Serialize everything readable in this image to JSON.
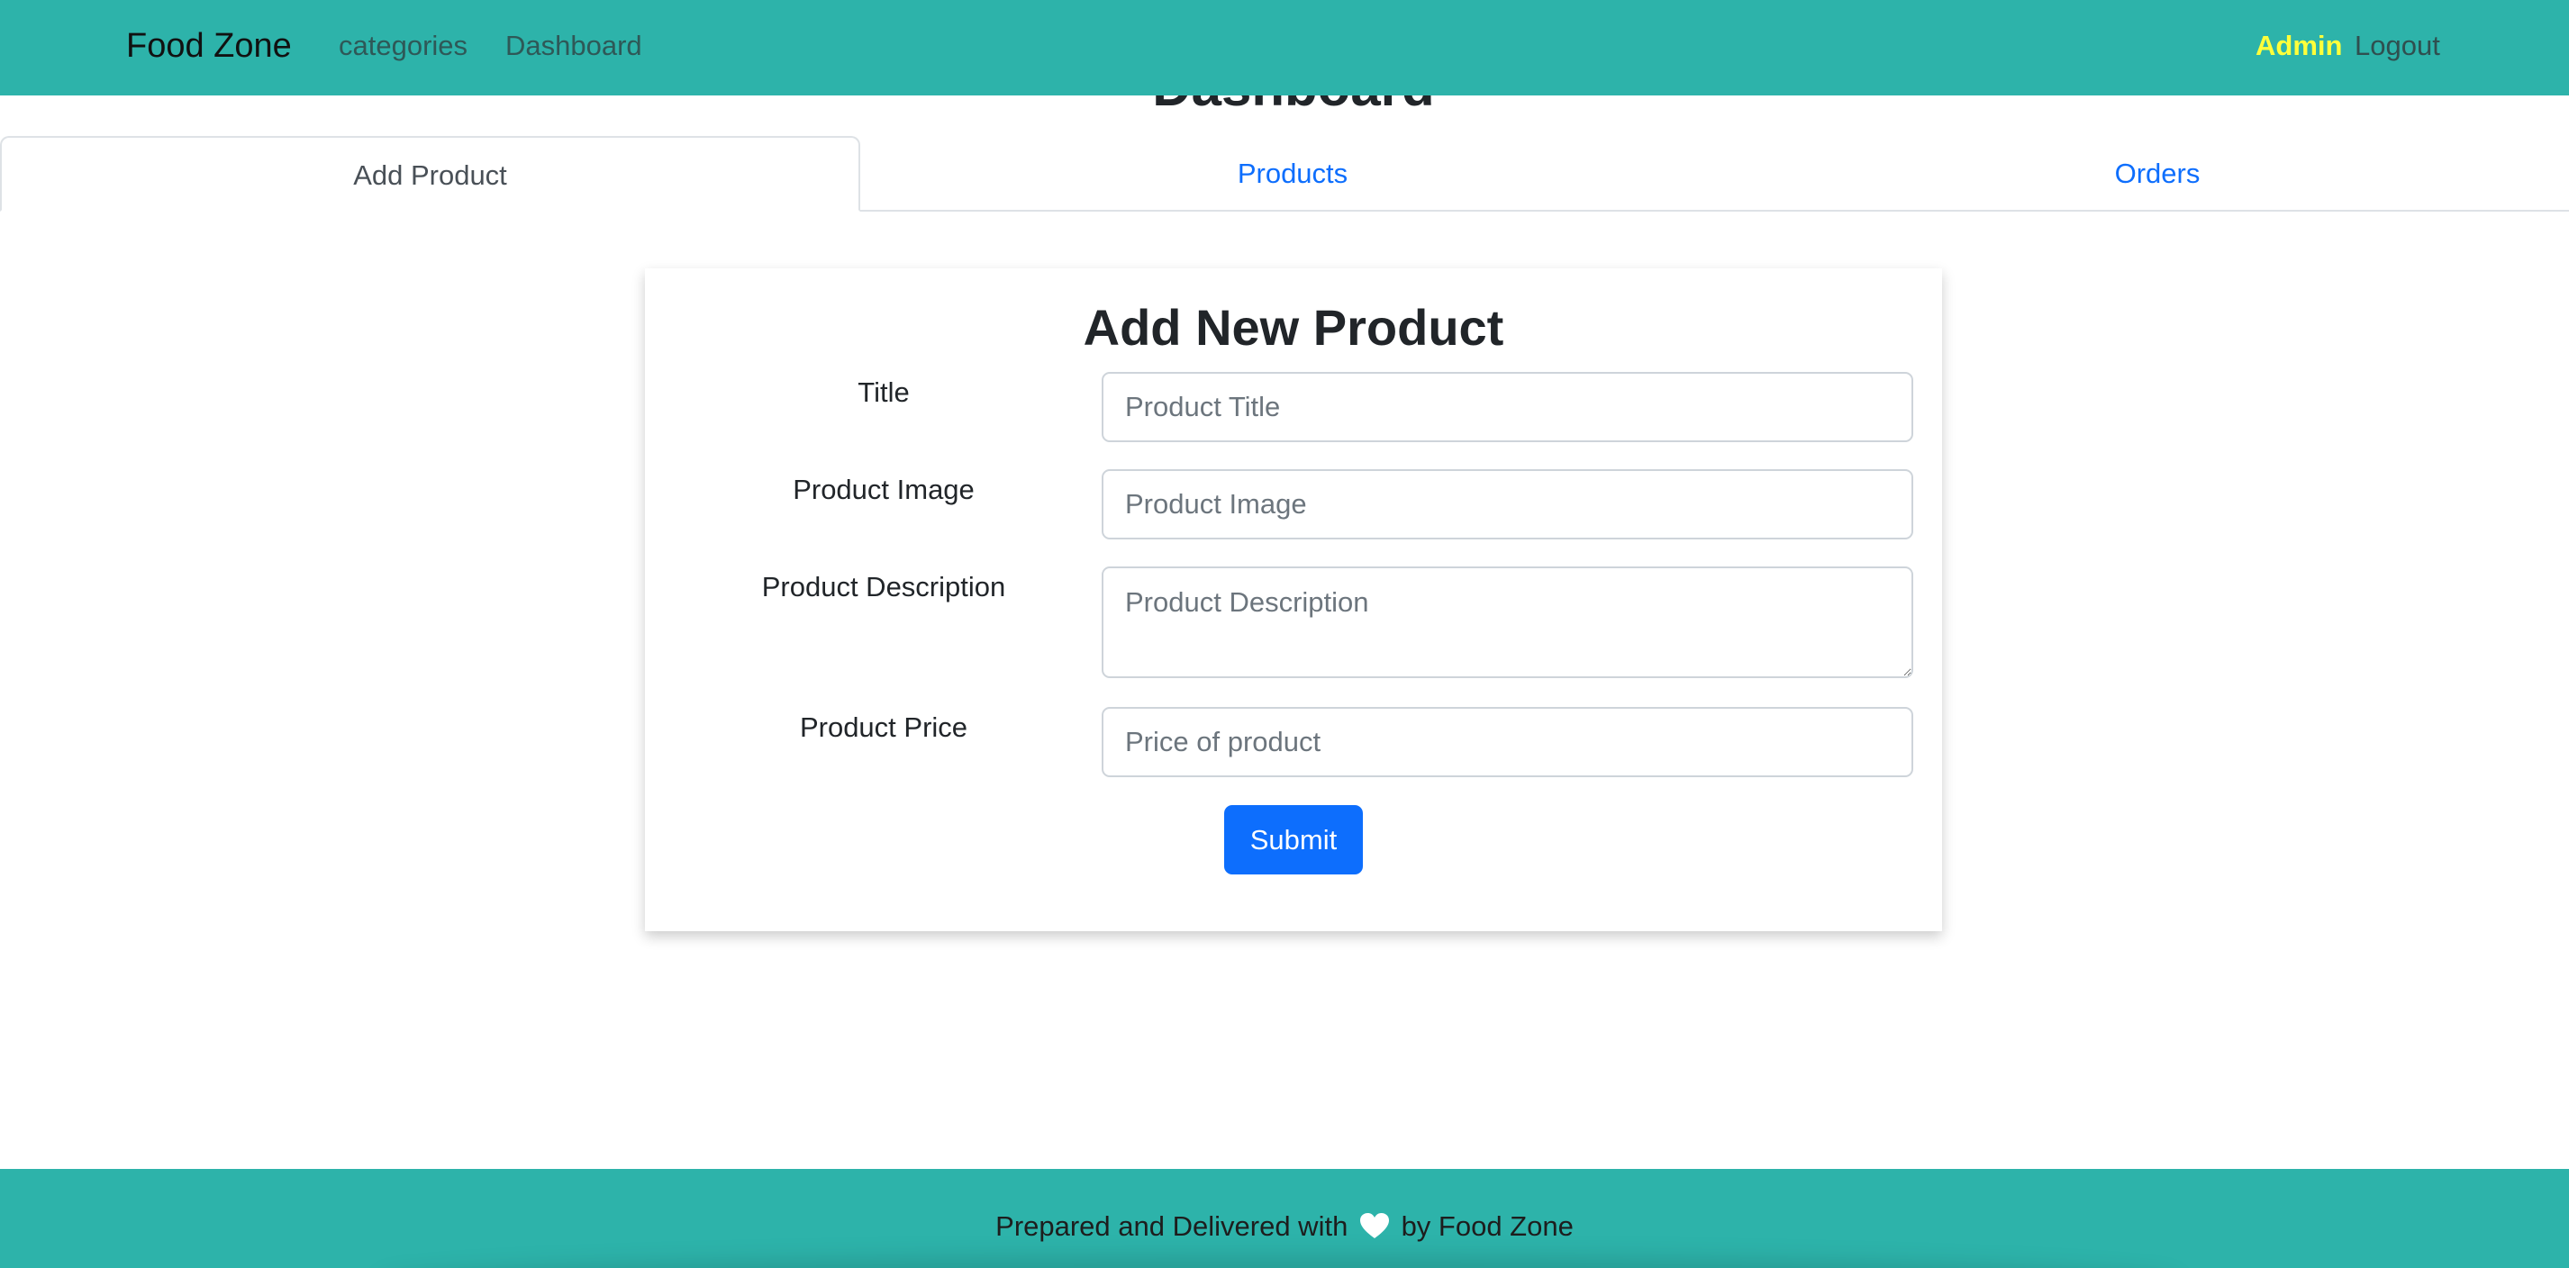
{
  "navbar": {
    "brand": "Food Zone",
    "links": {
      "categories": "categories",
      "dashboard": "Dashboard"
    },
    "admin": "Admin",
    "logout": "Logout"
  },
  "page": {
    "heading": "Dashboard"
  },
  "tabs": {
    "add_product": "Add Product",
    "products": "Products",
    "orders": "Orders"
  },
  "form": {
    "title": "Add New Product",
    "fields": {
      "title": {
        "label": "Title",
        "placeholder": "Product Title",
        "value": ""
      },
      "image": {
        "label": "Product Image",
        "placeholder": "Product Image",
        "value": ""
      },
      "description": {
        "label": "Product Description",
        "placeholder": "Product Description",
        "value": ""
      },
      "price": {
        "label": "Product Price",
        "placeholder": "Price of product",
        "value": ""
      }
    },
    "submit_label": "Submit"
  },
  "footer": {
    "text_before": "Prepared and Delivered with",
    "icon": "heart-icon",
    "text_after": "by Food Zone"
  },
  "colors": {
    "navbar_bg": "#2db3aa",
    "admin_text": "#ffff3a",
    "link_blue": "#0d6efd",
    "submit_bg": "#0d6efd"
  }
}
